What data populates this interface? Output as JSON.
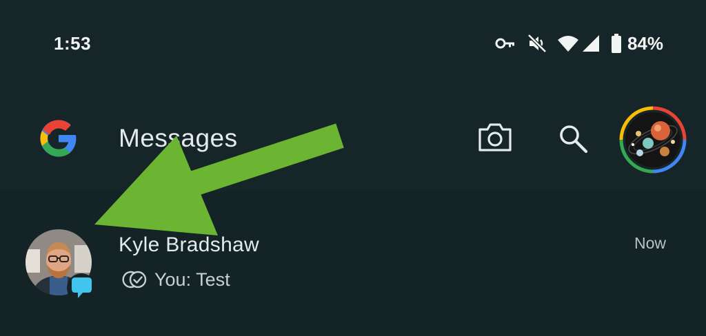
{
  "status_bar": {
    "time": "1:53",
    "battery_percent": "84%",
    "icons": [
      "vpn-key-icon",
      "mute-icon",
      "wifi-icon",
      "cell-signal-icon",
      "battery-icon"
    ]
  },
  "app_bar": {
    "logo": "google-g-icon",
    "title": "Messages",
    "actions": [
      "camera-icon",
      "search-icon",
      "account-avatar"
    ]
  },
  "conversations": [
    {
      "name": "Kyle Bradshaw",
      "snippet": "You: Test",
      "timestamp": "Now",
      "status_icon": "read-receipt-icon"
    }
  ],
  "overlay": {
    "annotation": "green-arrow-icon",
    "color": "#6bb532"
  },
  "colors": {
    "background": "#142325",
    "app_bar": "#162527",
    "text": "#e4ebea",
    "badge": "#3fc5ee"
  }
}
